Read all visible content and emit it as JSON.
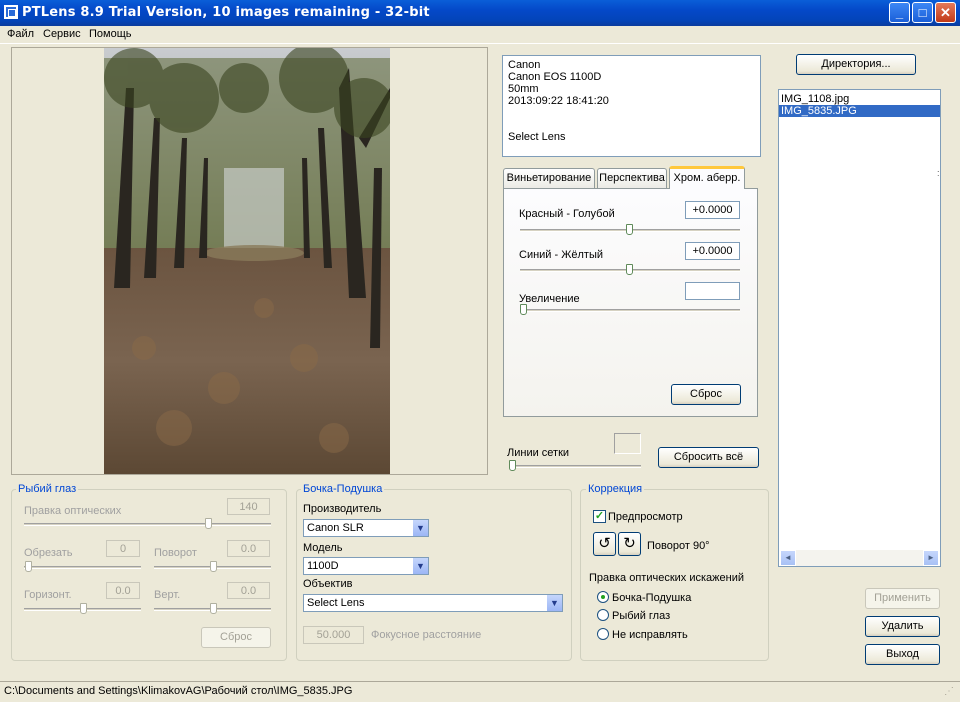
{
  "window": {
    "title": "PTLens 8.9 Trial Version, 10 images remaining - 32-bit",
    "minimize": "_",
    "maximize": "□",
    "close": "✕"
  },
  "menu": [
    "Файл",
    "Сервис",
    "Помощь"
  ],
  "info": {
    "make": "Canon",
    "model": "Canon EOS 1100D",
    "focal": "50mm",
    "datetime": "2013:09:22 18:41:20",
    "lens": "Select Lens"
  },
  "tabs": [
    "Виньетирование",
    "Перспектива",
    "Хром. аберр."
  ],
  "active_tab": 2,
  "chromatic": {
    "red_cyan": {
      "label": "Красный - Голубой",
      "value": "+0.0000",
      "level": 0.5
    },
    "blue_yellow": {
      "label": "Синий - Жёлтый",
      "value": "+0.0000",
      "level": 0.5
    },
    "magnify": {
      "label": "Увеличение",
      "value": "",
      "level": 0
    },
    "reset": "Сброс"
  },
  "grid": {
    "label": "Линии сетки",
    "level": 0
  },
  "reset_all": "Сбросить всё",
  "directory_button": "Директория...",
  "files": [
    {
      "name": "IMG_1108.jpg",
      "selected": false
    },
    {
      "name": "IMG_5835.JPG",
      "selected": true
    }
  ],
  "fisheye": {
    "title": "Рыбий глаз",
    "optical_label": "Правка оптических",
    "optical_value": "140",
    "crop_label": "Обрезать",
    "crop_value": "0",
    "rotate_label": "Поворот",
    "rotate_value": "0.0",
    "horiz_label": "Горизонт.",
    "horiz_value": "0.0",
    "vert_label": "Верт.",
    "vert_value": "0.0",
    "reset": "Сброс"
  },
  "barrel": {
    "title": "Бочка-Подушка",
    "maker_label": "Производитель",
    "maker_value": "Canon SLR",
    "model_label": "Модель",
    "model_value": "1100D",
    "lens_label": "Объектив",
    "lens_value": "Select Lens",
    "focal_value": "50.000",
    "focal_label": "Фокусное расстояние"
  },
  "correction": {
    "title": "Коррекция",
    "preview_label": "Предпросмотр",
    "preview_checked": true,
    "rotate_label": "Поворот 90°",
    "optical_label": "Правка оптических искажений",
    "options": [
      "Бочка-Подушка",
      "Рыбий глаз",
      "Не исправлять"
    ],
    "selected_option": 0
  },
  "actions": {
    "apply": "Применить",
    "delete": "Удалить",
    "exit": "Выход"
  },
  "status": "C:\\Documents and Settings\\KlimakovAG\\Рабочий стол\\IMG_5835.JPG",
  "colors": {
    "titlebar": "#0a5ed8",
    "group_title": "#0046d5",
    "selection": "#316ac5"
  }
}
